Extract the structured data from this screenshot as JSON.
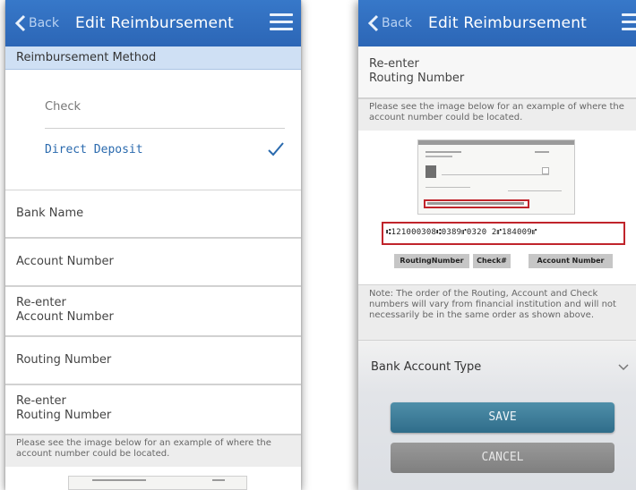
{
  "left": {
    "nav": {
      "back_label": "Back",
      "title": "Edit Reimbursement"
    },
    "section_header": "Reimbursement Method",
    "methods": [
      {
        "label": "Check",
        "selected": false
      },
      {
        "label": "Direct Deposit",
        "selected": true
      }
    ],
    "fields": [
      {
        "line1": "Bank Name"
      },
      {
        "line1": "Account Number"
      },
      {
        "line1": "Re-enter",
        "line2": "Account Number"
      },
      {
        "line1": "Routing Number"
      },
      {
        "line1": "Re-enter",
        "line2": "Routing Number"
      }
    ],
    "hint": "Please see the image below for an example of where the account number could be located."
  },
  "right": {
    "nav": {
      "back_label": "Back",
      "title": "Edit Reimbursement"
    },
    "field": {
      "line1": "Re-enter",
      "line2": "Routing Number"
    },
    "hint": "Please see the image below for an example of where the account number could be located.",
    "check_image": {
      "micr_line": "⑆121000308⑆0389⑈0320 2⑈184009⑈",
      "labels": [
        "RoutingNumber",
        "Check#",
        "Account Number"
      ]
    },
    "note": "Note: The order of the Routing, Account and Check numbers will vary from financial institution and will not necessarily be in the same order as shown above.",
    "bank_account_type_label": "Bank Account Type",
    "save_label": "SAVE",
    "cancel_label": "CANCEL"
  },
  "colors": {
    "nav_bar": "#2c66b6",
    "section_header": "#cfe0f4",
    "selected_text": "#2a6aae",
    "micr_highlight": "#c0242b",
    "save_button": "#3a7b98",
    "cancel_button": "#8a8a8a"
  },
  "icons": [
    "back-chevron-icon",
    "hamburger-menu-icon",
    "checkmark-icon",
    "chevron-down-icon"
  ]
}
